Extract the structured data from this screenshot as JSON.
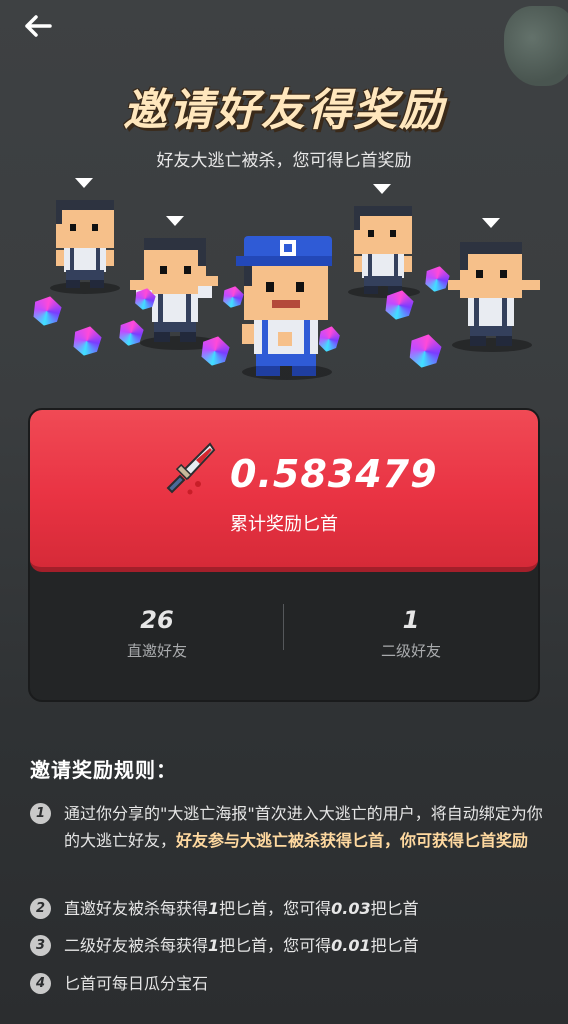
{
  "header": {
    "back_icon": "arrow-left-icon",
    "title": "邀请好友得奖励",
    "subtitle": "好友大逃亡被杀，您可得匕首奖励"
  },
  "reward_card": {
    "icon": "dagger-icon",
    "amount": "0.583479",
    "amount_label": "累计奖励匕首"
  },
  "stats": [
    {
      "value": "26",
      "label": "直邀好友"
    },
    {
      "value": "1",
      "label": "二级好友"
    }
  ],
  "rules": {
    "title": "邀请奖励规则：",
    "items": [
      {
        "num": "1",
        "text_a": "通过你分享的\"大逃亡海报\"首次进入大逃亡的用户，将自动绑定为你的大逃亡好友，",
        "highlight": "好友参与大逃亡被杀获得匕首，你可获得匕首奖励"
      },
      {
        "num": "2",
        "text_a": "直邀好友被杀每获得",
        "bold_a": "1",
        "text_b": "把匕首，您可得",
        "bold_b": "0.03",
        "text_c": "把匕首"
      },
      {
        "num": "3",
        "text_a": "二级好友被杀每获得",
        "bold_a": "1",
        "text_b": "把匕首，您可得",
        "bold_b": "0.01",
        "text_c": "把匕首"
      },
      {
        "num": "4",
        "text_a": "匕首可每日瓜分宝石"
      }
    ]
  },
  "colors": {
    "background": "#34373a",
    "card_red": "#e93343",
    "highlight": "#ffd9a0"
  }
}
